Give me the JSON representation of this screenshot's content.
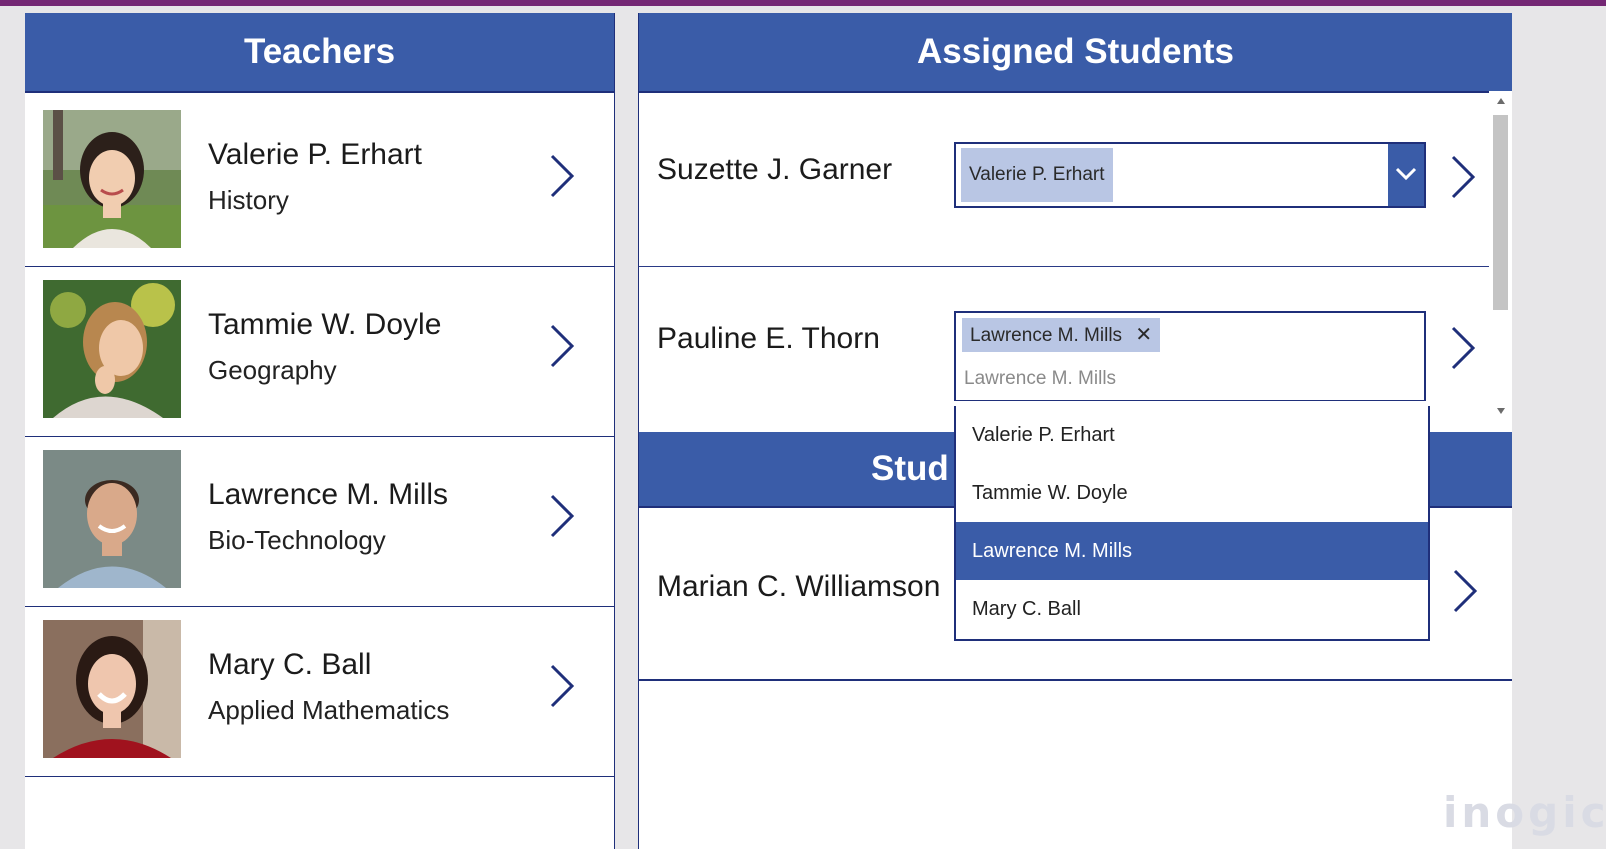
{
  "colors": {
    "accent": "#3a5ca8",
    "border": "#1f2f7a",
    "top_bar": "#742774",
    "chip": "#b9c6e4"
  },
  "teachers_panel": {
    "title": "Teachers",
    "items": [
      {
        "name": "Valerie P. Erhart",
        "subject": "History",
        "photo": "teacher-photo-valerie"
      },
      {
        "name": "Tammie W. Doyle",
        "subject": "Geography",
        "photo": "teacher-photo-tammie"
      },
      {
        "name": "Lawrence M. Mills",
        "subject": "Bio-Technology",
        "photo": "teacher-photo-lawrence"
      },
      {
        "name": "Mary C. Ball",
        "subject": "Applied Mathematics",
        "photo": "teacher-photo-mary"
      }
    ]
  },
  "assigned_panel": {
    "title": "Assigned Students",
    "rows": [
      {
        "student": "Suzette J. Garner",
        "selected_teacher": "Valerie P. Erhart"
      },
      {
        "student": "Pauline E. Thorn",
        "selected_teacher": "Lawrence M. Mills",
        "search_text": "Lawrence M. Mills"
      }
    ]
  },
  "students_panel": {
    "title": "Stud",
    "rows": [
      {
        "student": "Marian C. Williamson"
      }
    ]
  },
  "dropdown": {
    "options": [
      "Valerie P. Erhart",
      "Tammie W. Doyle",
      "Lawrence M. Mills",
      "Mary C. Ball"
    ],
    "selected": "Lawrence M. Mills"
  },
  "icons": {
    "chip_remove": "close-icon",
    "row_nav": "chevron-right-icon",
    "combo_open": "chevron-down-icon"
  },
  "watermark": "inogic"
}
